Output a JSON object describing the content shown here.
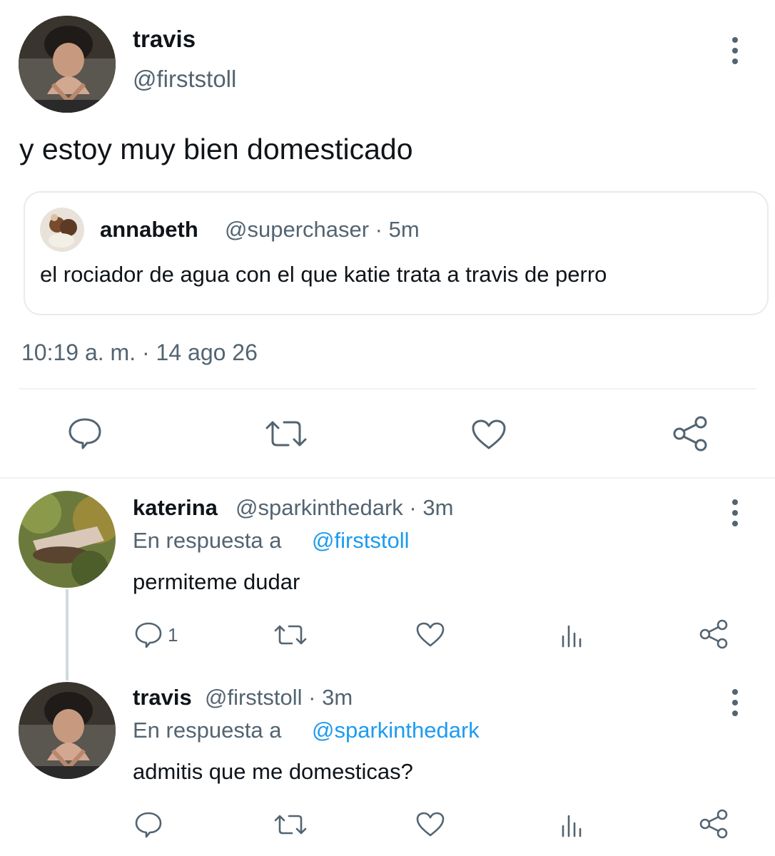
{
  "main_tweet": {
    "name": "travis",
    "handle": "@firststoll",
    "text": "y estoy muy bien domesticado",
    "quoted": {
      "name": "annabeth",
      "meta": "@superchaser · 5m",
      "text": "el rociador de agua con el que katie trata a travis de perro"
    },
    "timestamp": "10:19 a. m. · 14 ago 26"
  },
  "replies": [
    {
      "name": "katerina",
      "meta": "@sparkinthedark · 3m",
      "reply_prefix": "En respuesta a",
      "reply_to": "@firststoll",
      "text": "permiteme dudar",
      "reply_count": "1"
    },
    {
      "name": "travis",
      "meta": "@firststoll · 3m",
      "reply_prefix": "En respuesta a",
      "reply_to": "@sparkinthedark",
      "text": "admitis que me domesticas?",
      "reply_count": ""
    }
  ],
  "icons": {
    "reply": "speech-bubble-icon",
    "retweet": "retweet-icon",
    "like": "heart-icon",
    "analytics": "bar-chart-icon",
    "share": "share-icon",
    "more": "vertical-dots-icon"
  },
  "colors": {
    "text": "#0f1419",
    "muted": "#536471",
    "link": "#1d9bf0",
    "divider": "#eff3f4"
  }
}
